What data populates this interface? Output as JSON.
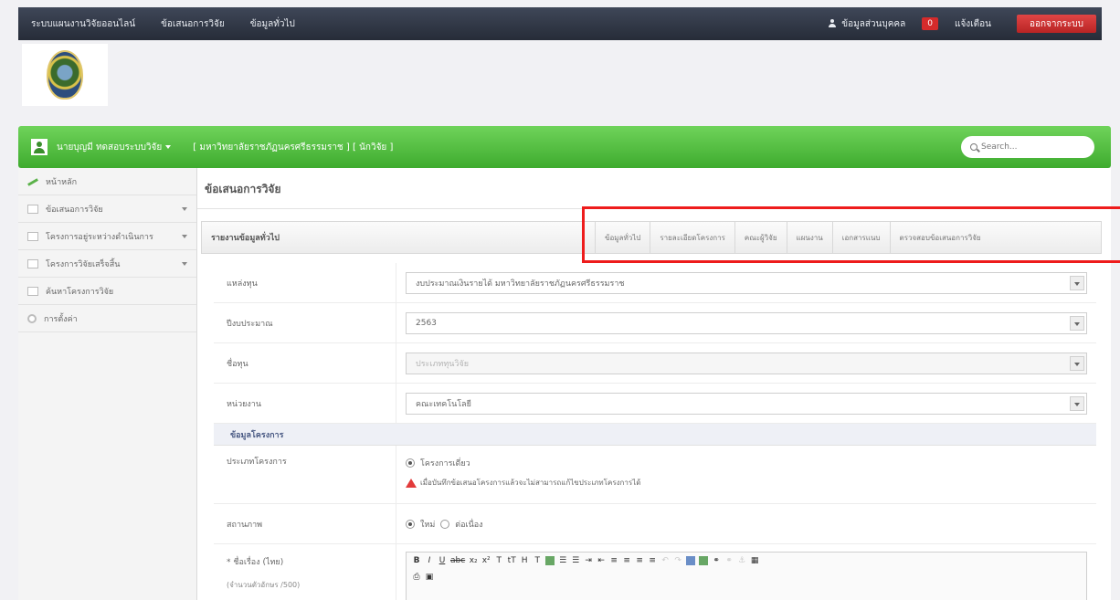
{
  "topbar": {
    "nav": [
      "ระบบแผนงานวิจัยออนไลน์",
      "ข้อเสนอการวิจัย",
      "ข้อมูลทั่วไป"
    ],
    "user_link": "ข้อมูลส่วนบุคคล",
    "badge": "0",
    "message_link": "แจ้งเตือน",
    "logout_label": "ออกจากระบบ"
  },
  "greenbar": {
    "user_name": "นายบุญมี ทดสอบระบบวิจัย",
    "org": "[ มหาวิทยาลัยราชภัฏนครศรีธรรมราช ] [ นักวิจัย ]",
    "search_placeholder": "Search..."
  },
  "sidebar": {
    "items": [
      {
        "label": "หน้าหลัก",
        "icon": "chart-icon",
        "arrow": false
      },
      {
        "label": "ข้อเสนอการวิจัย",
        "icon": "doc-icon",
        "arrow": true
      },
      {
        "label": "โครงการอยู่ระหว่างดำเนินการ",
        "icon": "doc-icon",
        "arrow": true
      },
      {
        "label": "โครงการวิจัยเสร็จสิ้น",
        "icon": "list-icon",
        "arrow": true
      },
      {
        "label": "ค้นหาโครงการวิจัย",
        "icon": "doc-icon",
        "arrow": false
      },
      {
        "label": "การตั้งค่า",
        "icon": "gear-icon",
        "arrow": false
      }
    ]
  },
  "main": {
    "page_title": "ข้อเสนอการวิจัย",
    "panel_title": "รายงานข้อมูลทั่วไป",
    "tabs": [
      "ข้อมูลทั่วไป",
      "รายละเอียดโครงการ",
      "คณะผู้วิจัย",
      "แผนงาน",
      "เอกสารแนบ",
      "ตรวจสอบข้อเสนอการวิจัย"
    ]
  },
  "form": {
    "rows": [
      {
        "label": "แหล่งทุน",
        "value": "งบประมาณเงินรายได้ มหาวิทยาลัยราชภัฏนครศรีธรรมราช",
        "disabled": false
      },
      {
        "label": "ปีงบประมาณ",
        "value": "2563",
        "disabled": false
      },
      {
        "label": "ชื่อทุน",
        "value": "ประเภททุนวิจัย",
        "disabled": true
      },
      {
        "label": "หน่วยงาน",
        "value": "คณะเทคโนโลยี",
        "disabled": false
      }
    ],
    "section_title": "ข้อมูลโครงการ",
    "project_type_label": "ประเภทโครงการ",
    "project_type_value": "โครงการเดี่ยว",
    "warning": "เมื่อบันทึกข้อเสนอโครงการแล้วจะไม่สามารถแก้ไขประเภทโครงการได้",
    "status_label": "สถานภาพ",
    "status_new": "ใหม่",
    "status_cont": "ต่อเนื่อง",
    "name_label": "* ชื่อเรื่อง (ไทย)",
    "name_hint": "(จำนวนตัวอักษร /500)"
  }
}
